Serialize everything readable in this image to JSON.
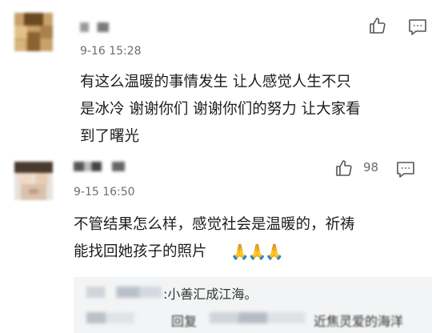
{
  "comments": [
    {
      "time": "9-16 15:28",
      "text_lines": [
        "有这么温暖的事情发生 让人感觉人生不只",
        "是冰冷 谢谢你们 谢谢你们的努力 让大家看",
        "到了曙光"
      ],
      "icons": [
        "thumbs-up-icon",
        "comment-icon"
      ]
    },
    {
      "time": "9-15 16:50",
      "like_count": "98",
      "text_lines": [
        "不管结果怎么样，感觉社会是温暖的，祈祷",
        "能找回她孩子的照片"
      ],
      "emoji": "🙏🙏🙏",
      "icons": [
        "thumbs-up-icon",
        "comment-icon"
      ],
      "reply": {
        "text": ":小善汇成江海。",
        "second_line_partial_1": "回复",
        "second_line_partial_2": "近焦灵爱的海洋"
      }
    }
  ],
  "colors": {
    "background": "#ffffff",
    "text": "#1d1d1d",
    "meta": "#6f6f6f",
    "reply_bg": "#f3f4f5"
  }
}
